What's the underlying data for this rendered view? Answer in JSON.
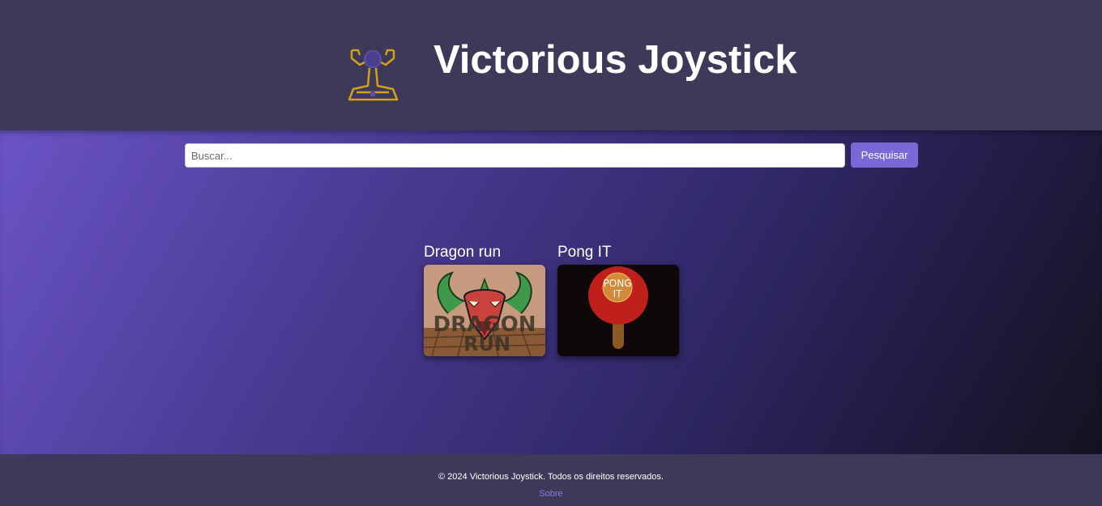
{
  "header": {
    "logo_icon": "trophy-joystick-icon",
    "title": "Victorious Joystick"
  },
  "search": {
    "placeholder": "Buscar...",
    "value": "",
    "button_label": "Pesquisar"
  },
  "games": [
    {
      "title": "Dragon run",
      "thumb_text": "DRAGON RUN",
      "thumb_icon": "dragon-head-icon"
    },
    {
      "title": "Pong IT",
      "thumb_text": "PONG IT",
      "thumb_icon": "ping-pong-paddle-icon"
    }
  ],
  "footer": {
    "copyright": "© 2024 Victorious Joystick. Todos os direitos reservados.",
    "about_link": "Sobre"
  },
  "colors": {
    "accent": "#7b68d6",
    "header_bg": "#3d3a59",
    "logo_gold": "#d4a019"
  }
}
